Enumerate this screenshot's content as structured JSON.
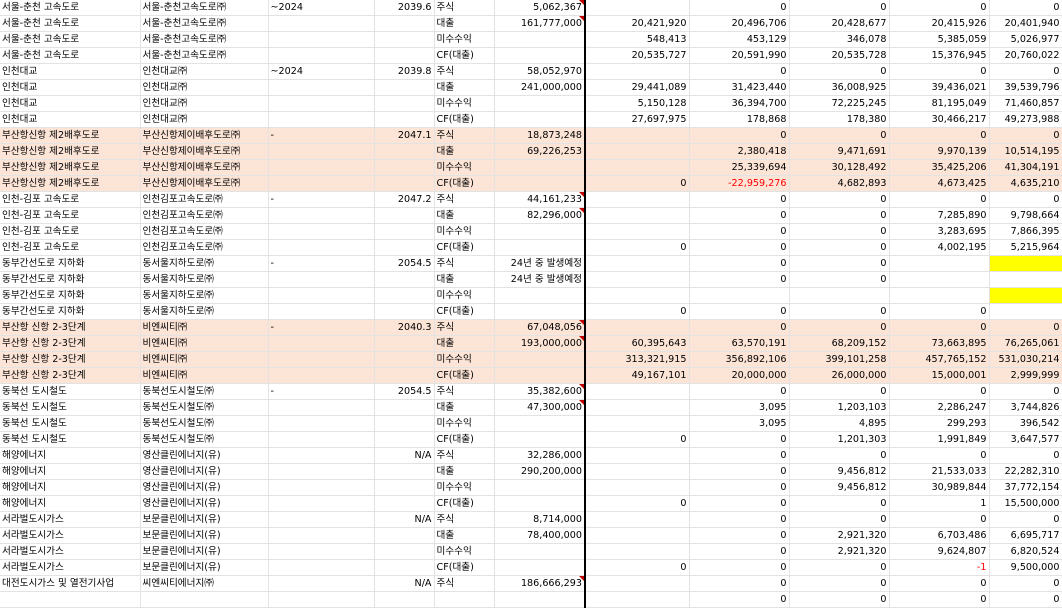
{
  "rows": [
    {
      "a": "서울-춘천 고속도로",
      "b": "서울-춘천고속도로㈜",
      "c": "~2024",
      "d": "2039.6",
      "e": "주식",
      "f": "5,062,367",
      "v": [
        "",
        "0",
        "0",
        "0",
        "0"
      ],
      "pink": false,
      "tri": true
    },
    {
      "a": "서울-춘천 고속도로",
      "b": "서울-춘천고속도로㈜",
      "c": "",
      "d": "",
      "e": "대출",
      "f": "161,777,000",
      "v": [
        "20,421,920",
        "20,496,706",
        "20,428,677",
        "20,415,926",
        "20,401,940"
      ],
      "pink": false,
      "tri": true
    },
    {
      "a": "서울-춘천 고속도로",
      "b": "서울-춘천고속도로㈜",
      "c": "",
      "d": "",
      "e": "미수수익",
      "f": "",
      "v": [
        "548,413",
        "453,129",
        "346,078",
        "5,385,059",
        "5,026,977"
      ],
      "pink": false,
      "tri": false
    },
    {
      "a": "서울-춘천 고속도로",
      "b": "서울-춘천고속도로㈜",
      "c": "",
      "d": "",
      "e": "CF(대출)",
      "f": "",
      "v": [
        "20,535,727",
        "20,591,990",
        "20,535,728",
        "15,376,945",
        "20,760,022"
      ],
      "pink": false,
      "tri": false
    },
    {
      "a": "인천대교",
      "b": "인천대교㈜",
      "c": "~2024",
      "d": "2039.8",
      "e": "주식",
      "f": "58,052,970",
      "v": [
        "",
        "0",
        "0",
        "0",
        "0"
      ],
      "pink": false,
      "tri": false
    },
    {
      "a": "인천대교",
      "b": "인천대교㈜",
      "c": "",
      "d": "",
      "e": "대출",
      "f": "241,000,000",
      "v": [
        "29,441,089",
        "31,423,440",
        "36,008,925",
        "39,436,021",
        "39,539,796"
      ],
      "pink": false,
      "tri": false
    },
    {
      "a": "인천대교",
      "b": "인천대교㈜",
      "c": "",
      "d": "",
      "e": "미수수익",
      "f": "",
      "v": [
        "5,150,128",
        "36,394,700",
        "72,225,245",
        "81,195,049",
        "71,460,857"
      ],
      "pink": false,
      "tri": false
    },
    {
      "a": "인천대교",
      "b": "인천대교㈜",
      "c": "",
      "d": "",
      "e": "CF(대출)",
      "f": "",
      "v": [
        "27,697,975",
        "178,868",
        "178,380",
        "30,466,217",
        "49,273,988"
      ],
      "pink": false,
      "tri": false
    },
    {
      "a": "부산항신항 제2배후도로",
      "b": "부산신항제이배후도로㈜",
      "c": "-",
      "d": "2047.1",
      "e": "주식",
      "f": "18,873,248",
      "v": [
        "",
        "0",
        "0",
        "0",
        "0"
      ],
      "pink": true,
      "tri": false
    },
    {
      "a": "부산항신항 제2배후도로",
      "b": "부산신항제이배후도로㈜",
      "c": "",
      "d": "",
      "e": "대출",
      "f": "69,226,253",
      "v": [
        "",
        "2,380,418",
        "9,471,691",
        "9,970,139",
        "10,514,195"
      ],
      "pink": true,
      "tri": false
    },
    {
      "a": "부산항신항 제2배후도로",
      "b": "부산신항제이배후도로㈜",
      "c": "",
      "d": "",
      "e": "미수수익",
      "f": "",
      "v": [
        "",
        "25,339,694",
        "30,128,492",
        "35,425,206",
        "41,304,191"
      ],
      "pink": true,
      "tri": false
    },
    {
      "a": "부산항신항 제2배후도로",
      "b": "부산신항제이배후도로㈜",
      "c": "",
      "d": "",
      "e": "CF(대출)",
      "f": "",
      "v": [
        "0",
        "-22,959,276",
        "4,682,893",
        "4,673,425",
        "4,635,210"
      ],
      "pink": true,
      "tri": false,
      "neg": 1
    },
    {
      "a": "인천-김포 고속도로",
      "b": "인천김포고속도로㈜",
      "c": "-",
      "d": "2047.2",
      "e": "주식",
      "f": "44,161,233",
      "v": [
        "",
        "0",
        "0",
        "0",
        "0"
      ],
      "pink": false,
      "tri": true
    },
    {
      "a": "인천-김포 고속도로",
      "b": "인천김포고속도로㈜",
      "c": "",
      "d": "",
      "e": "대출",
      "f": "82,296,000",
      "v": [
        "",
        "0",
        "0",
        "7,285,890",
        "9,798,664"
      ],
      "pink": false,
      "tri": true
    },
    {
      "a": "인천-김포 고속도로",
      "b": "인천김포고속도로㈜",
      "c": "",
      "d": "",
      "e": "미수수익",
      "f": "",
      "v": [
        "",
        "0",
        "0",
        "3,283,695",
        "7,866,395"
      ],
      "pink": false,
      "tri": false
    },
    {
      "a": "인천-김포 고속도로",
      "b": "인천김포고속도로㈜",
      "c": "",
      "d": "",
      "e": "CF(대출)",
      "f": "",
      "v": [
        "0",
        "0",
        "0",
        "4,002,195",
        "5,215,964"
      ],
      "pink": false,
      "tri": false
    },
    {
      "a": "동부간선도로 지하화",
      "b": "동서울지하도로㈜",
      "c": "-",
      "d": "2054.5",
      "e": "주식",
      "f": "24년 중 발생예정",
      "v": [
        "",
        "0",
        "0",
        "",
        "Y"
      ],
      "pink": false,
      "tri": false
    },
    {
      "a": "동부간선도로 지하화",
      "b": "동서울지하도로㈜",
      "c": "",
      "d": "",
      "e": "대출",
      "f": "24년 중 발생예정",
      "v": [
        "",
        "0",
        "0",
        "",
        ""
      ],
      "pink": false,
      "tri": false
    },
    {
      "a": "동부간선도로 지하화",
      "b": "동서울지하도로㈜",
      "c": "",
      "d": "",
      "e": "미수수익",
      "f": "",
      "v": [
        "",
        "",
        "",
        "",
        "Y"
      ],
      "pink": false,
      "tri": false
    },
    {
      "a": "동부간선도로 지하화",
      "b": "동서울지하도로㈜",
      "c": "",
      "d": "",
      "e": "CF(대출)",
      "f": "",
      "v": [
        "0",
        "0",
        "0",
        "0",
        ""
      ],
      "pink": false,
      "tri": false
    },
    {
      "a": "부산항 신항 2-3단계",
      "b": "비엔씨티㈜",
      "c": "-",
      "d": "2040.3",
      "e": "주식",
      "f": "67,048,056",
      "v": [
        "",
        "0",
        "0",
        "0",
        "0"
      ],
      "pink": true,
      "tri": true
    },
    {
      "a": "부산항 신항 2-3단계",
      "b": "비엔씨티㈜",
      "c": "",
      "d": "",
      "e": "대출",
      "f": "193,000,000",
      "v": [
        "60,395,643",
        "63,570,191",
        "68,209,152",
        "73,663,895",
        "76,265,061"
      ],
      "pink": true,
      "tri": true
    },
    {
      "a": "부산항 신항 2-3단계",
      "b": "비엔씨티㈜",
      "c": "",
      "d": "",
      "e": "미수수익",
      "f": "",
      "v": [
        "313,321,915",
        "356,892,106",
        "399,101,258",
        "457,765,152",
        "531,030,214"
      ],
      "pink": true,
      "tri": false
    },
    {
      "a": "부산항 신항 2-3단계",
      "b": "비엔씨티㈜",
      "c": "",
      "d": "",
      "e": "CF(대출)",
      "f": "",
      "v": [
        "49,167,101",
        "20,000,000",
        "26,000,000",
        "15,000,001",
        "2,999,999"
      ],
      "pink": true,
      "tri": false
    },
    {
      "a": "동북선 도시철도",
      "b": "동북선도시철도㈜",
      "c": "-",
      "d": "2054.5",
      "e": "주식",
      "f": "35,382,600",
      "v": [
        "",
        "0",
        "0",
        "0",
        "0"
      ],
      "pink": false,
      "tri": true
    },
    {
      "a": "동북선 도시철도",
      "b": "동북선도시철도㈜",
      "c": "",
      "d": "",
      "e": "대출",
      "f": "47,300,000",
      "v": [
        "",
        "3,095",
        "1,203,103",
        "2,286,247",
        "3,744,826"
      ],
      "pink": false,
      "tri": true
    },
    {
      "a": "동북선 도시철도",
      "b": "동북선도시철도㈜",
      "c": "",
      "d": "",
      "e": "미수수익",
      "f": "",
      "v": [
        "",
        "3,095",
        "4,895",
        "299,293",
        "396,542"
      ],
      "pink": false,
      "tri": false
    },
    {
      "a": "동북선 도시철도",
      "b": "동북선도시철도㈜",
      "c": "",
      "d": "",
      "e": "CF(대출)",
      "f": "",
      "v": [
        "0",
        "0",
        "1,201,303",
        "1,991,849",
        "3,647,577"
      ],
      "pink": false,
      "tri": false
    },
    {
      "a": "해양에너지",
      "b": "영산클린에너지(유)",
      "c": "",
      "d": "N/A",
      "e": "주식",
      "f": "32,286,000",
      "v": [
        "",
        "0",
        "0",
        "0",
        "0"
      ],
      "pink": false,
      "tri": false
    },
    {
      "a": "해양에너지",
      "b": "영산클린에너지(유)",
      "c": "",
      "d": "",
      "e": "대출",
      "f": "290,200,000",
      "v": [
        "",
        "0",
        "9,456,812",
        "21,533,033",
        "22,282,310"
      ],
      "pink": false,
      "tri": false
    },
    {
      "a": "해양에너지",
      "b": "영산클린에너지(유)",
      "c": "",
      "d": "",
      "e": "미수수익",
      "f": "",
      "v": [
        "",
        "0",
        "9,456,812",
        "30,989,844",
        "37,772,154"
      ],
      "pink": false,
      "tri": false
    },
    {
      "a": "해양에너지",
      "b": "영산클린에너지(유)",
      "c": "",
      "d": "",
      "e": "CF(대출)",
      "f": "",
      "v": [
        "0",
        "0",
        "0",
        "1",
        "15,500,000"
      ],
      "pink": false,
      "tri": false
    },
    {
      "a": "서라벌도시가스",
      "b": "보문클린에너지(유)",
      "c": "",
      "d": "N/A",
      "e": "주식",
      "f": "8,714,000",
      "v": [
        "",
        "0",
        "0",
        "0",
        "0"
      ],
      "pink": false,
      "tri": false
    },
    {
      "a": "서라벌도시가스",
      "b": "보문클린에너지(유)",
      "c": "",
      "d": "",
      "e": "대출",
      "f": "78,400,000",
      "v": [
        "",
        "0",
        "2,921,320",
        "6,703,486",
        "6,695,717"
      ],
      "pink": false,
      "tri": false
    },
    {
      "a": "서라벌도시가스",
      "b": "보문클린에너지(유)",
      "c": "",
      "d": "",
      "e": "미수수익",
      "f": "",
      "v": [
        "",
        "0",
        "2,921,320",
        "9,624,807",
        "6,820,524"
      ],
      "pink": false,
      "tri": false
    },
    {
      "a": "서라벌도시가스",
      "b": "보문클린에너지(유)",
      "c": "",
      "d": "",
      "e": "CF(대출)",
      "f": "",
      "v": [
        "0",
        "0",
        "0",
        "-1",
        "9,500,000"
      ],
      "pink": false,
      "tri": false,
      "neg": 3
    },
    {
      "a": "대전도시가스 및 열전기사업",
      "b": "씨엔씨티에너지㈜",
      "c": "",
      "d": "N/A",
      "e": "주식",
      "f": "186,666,293",
      "v": [
        "",
        "0",
        "0",
        "0",
        "0"
      ],
      "pink": false,
      "tri": true
    },
    {
      "a": "",
      "b": "",
      "c": "",
      "d": "",
      "e": "",
      "f": "",
      "v": [
        "",
        "0",
        "0",
        "0",
        "0"
      ],
      "pink": false,
      "tri": false
    }
  ]
}
